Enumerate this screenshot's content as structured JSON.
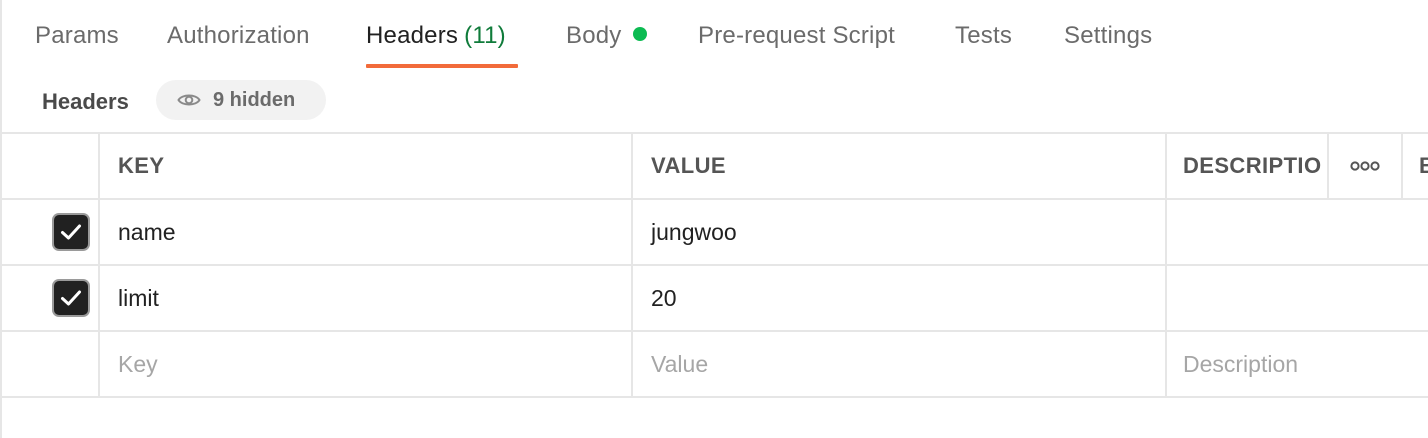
{
  "tabs": [
    {
      "label": "Params"
    },
    {
      "label": "Authorization"
    },
    {
      "label": "Headers",
      "count": "(11)"
    },
    {
      "label": "Body"
    },
    {
      "label": "Pre-request Script"
    },
    {
      "label": "Tests"
    },
    {
      "label": "Settings"
    }
  ],
  "active_tab": "Headers",
  "colors": {
    "active_underline": "#f26b3a",
    "count_text": "#0f7b3a",
    "body_dot": "#0cbb52"
  },
  "section": {
    "title": "Headers",
    "hidden_label": "9 hidden",
    "hidden_icon": "eye-icon"
  },
  "table": {
    "columns": {
      "key": "KEY",
      "value": "VALUE",
      "description": "DESCRIPTIO",
      "more_icon": "more-options-icon",
      "extra": "B"
    },
    "rows": [
      {
        "checked": true,
        "key": "name",
        "value": "jungwoo",
        "description": ""
      },
      {
        "checked": true,
        "key": "limit",
        "value": "20",
        "description": ""
      }
    ],
    "new_row": {
      "key_placeholder": "Key",
      "value_placeholder": "Value",
      "description_placeholder": "Description"
    }
  }
}
